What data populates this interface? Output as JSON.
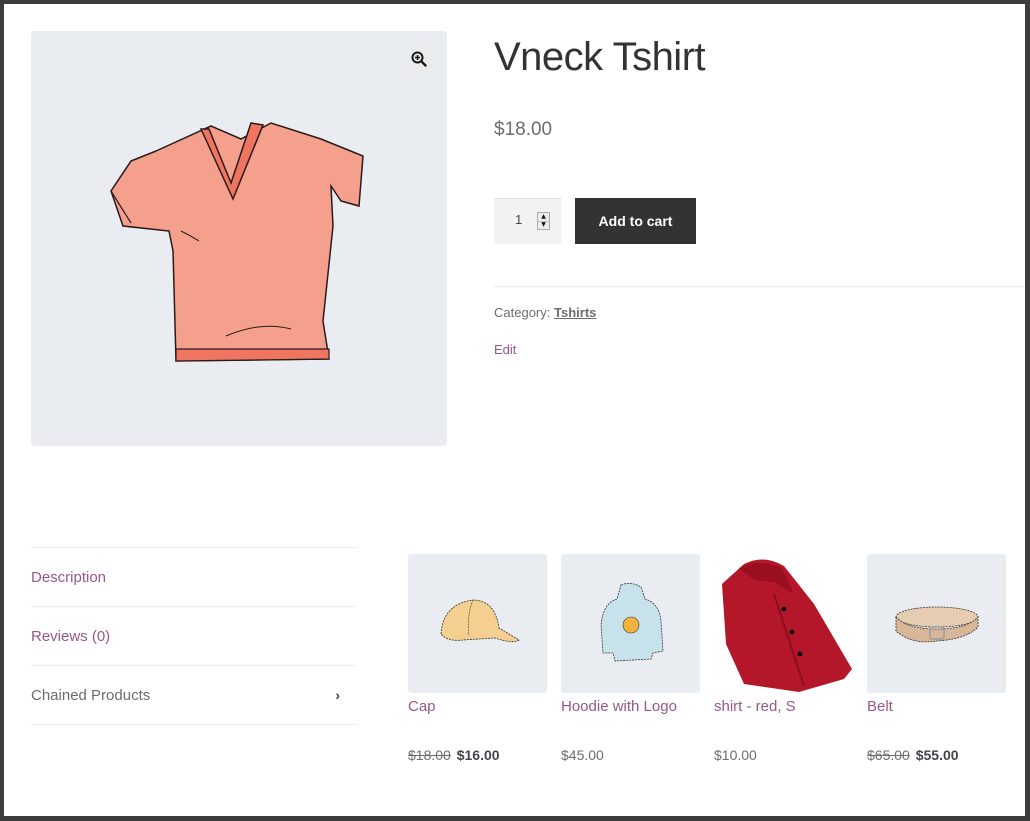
{
  "product": {
    "title": "Vneck Tshirt",
    "price": "$18.00",
    "quantity": "1",
    "add_to_cart_label": "Add to cart",
    "category_label": "Category:",
    "category_value": "Tshirts",
    "edit_label": "Edit",
    "image_icon": "vneck-tshirt-image",
    "zoom_icon": "magnifier-plus-icon"
  },
  "tabs": [
    {
      "label": "Description",
      "active": false
    },
    {
      "label": "Reviews (0)",
      "active": false
    },
    {
      "label": "Chained Products",
      "active": true,
      "icon": "chevron-right-icon",
      "chevron": "›"
    }
  ],
  "related_products": [
    {
      "name": "Cap",
      "regular_price": "$18.00",
      "sale_price": "$16.00",
      "image": "cap-image"
    },
    {
      "name": "Hoodie with Logo",
      "price": "$45.00",
      "image": "hoodie-image"
    },
    {
      "name": "shirt - red, S",
      "price": "$10.00",
      "image": "red-shirt-image"
    },
    {
      "name": "Belt",
      "regular_price": "$65.00",
      "sale_price": "$55.00",
      "image": "belt-image"
    }
  ],
  "colors": {
    "link": "#96588a",
    "button_bg": "#333333",
    "gallery_bg": "#e9edf1",
    "frame": "#3e3d3d"
  }
}
